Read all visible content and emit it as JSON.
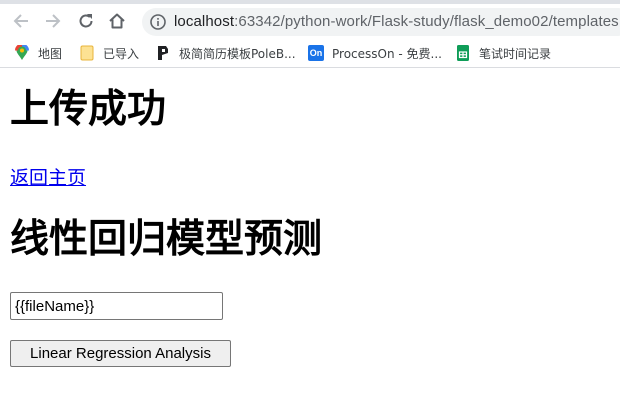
{
  "browser": {
    "address_bar": {
      "host": "localhost",
      "path": ":63342/python-work/Flask-study/flask_demo02/templates"
    },
    "bookmarks": [
      {
        "label": "地图",
        "icon": "maps-pin-icon"
      },
      {
        "label": "已导入",
        "icon": "folder-icon"
      },
      {
        "label": "极简简历模板PoleB...",
        "icon": "poleb-icon"
      },
      {
        "label": "ProcessOn - 免费...",
        "icon": "processon-icon",
        "icon_text": "On"
      },
      {
        "label": "笔试时间记录",
        "icon": "sheets-icon"
      }
    ]
  },
  "page": {
    "upload_heading": "上传成功",
    "home_link": "返回主页",
    "model_heading": "线性回归模型预测",
    "file_input_value": "{{fileName}}",
    "analyze_button": "Linear Regression Analysis"
  },
  "colors": {
    "link": "#0000ee",
    "chrome_bg": "#dee1e6",
    "omnibox_bg": "#f1f3f4"
  }
}
